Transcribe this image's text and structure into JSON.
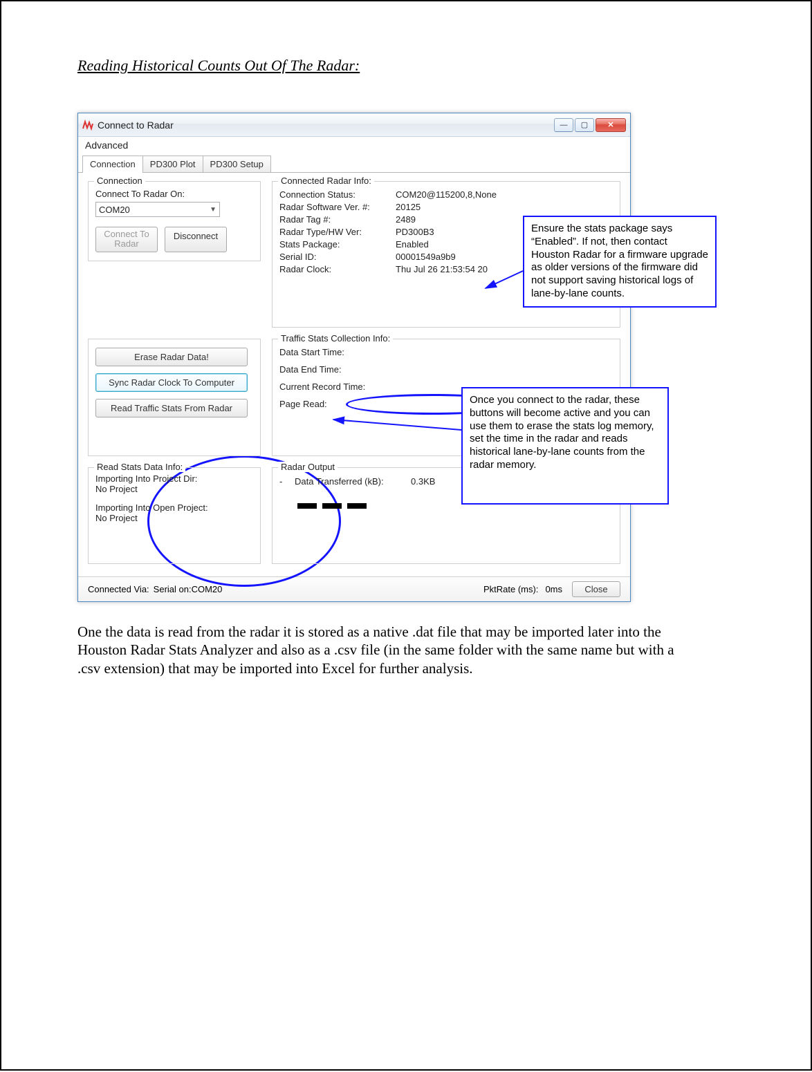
{
  "doc": {
    "heading": "Reading Historical Counts Out Of The Radar:",
    "paragraph": "One the data is read from the radar it is stored as a native .dat file that may be imported later into the Houston Radar Stats Analyzer and also as a .csv file (in the same folder with the same name but with a .csv extension) that may be imported into Excel for further analysis."
  },
  "window": {
    "title": "Connect to Radar",
    "menu": {
      "advanced": "Advanced"
    },
    "tabs": {
      "connection": "Connection",
      "pd300_plot": "PD300 Plot",
      "pd300_setup": "PD300 Setup"
    },
    "connection": {
      "legend": "Connection",
      "connect_on_label": "Connect To Radar On:",
      "port_value": "COM20",
      "connect_btn": "Connect To\nRadar",
      "disconnect_btn": "Disconnect"
    },
    "radar_info": {
      "legend": "Connected Radar Info:",
      "rows": {
        "status_k": "Connection Status:",
        "status_v": "COM20@115200,8,None",
        "sw_k": "Radar Software Ver. #:",
        "sw_v": "20125",
        "tag_k": "Radar Tag #:",
        "tag_v": "2489",
        "type_k": "Radar Type/HW Ver:",
        "type_v": "PD300B3",
        "stats_k": "Stats Package:",
        "stats_v": "Enabled",
        "serial_k": "Serial ID:",
        "serial_v": "00001549a9b9",
        "clock_k": "Radar Clock:",
        "clock_v": "Thu Jul 26 21:53:54 20"
      }
    },
    "action_buttons": {
      "erase": "Erase Radar Data!",
      "sync": "Sync Radar Clock To Computer",
      "read": "Read Traffic Stats From Radar"
    },
    "traffic_stats": {
      "legend": "Traffic Stats Collection Info:",
      "start_k": "Data Start Time:",
      "end_k": "Data End Time:",
      "cur_k": "Current Record Time:",
      "page_k": "Page Read:"
    },
    "read_stats": {
      "legend": "Read Stats Data Info:",
      "dir_k": "Importing Into Project Dir:",
      "dir_v": "No Project",
      "open_k": "Importing Into Open Project:",
      "open_v": "No Project"
    },
    "radar_output": {
      "legend": "Radar Output",
      "dash": "-",
      "xfer_k": "Data Transferred (kB):",
      "xfer_v": "0.3KB"
    },
    "status": {
      "via_k": "Connected Via:",
      "via_v": "Serial on:COM20",
      "pkt_k": "PktRate (ms):",
      "pkt_v": "0ms",
      "close": "Close"
    }
  },
  "callouts": {
    "stats_enabled": "Ensure the stats package says “Enabled”. If not, then contact Houston Radar for a firmware upgrade as older versions of the firmware did not support saving historical logs of lane-by-lane counts.",
    "buttons_active": "Once you connect to the radar, these buttons will become active and you can use them to erase the stats log memory, set the time in the radar and reads historical lane-by-lane counts from the radar memory."
  }
}
